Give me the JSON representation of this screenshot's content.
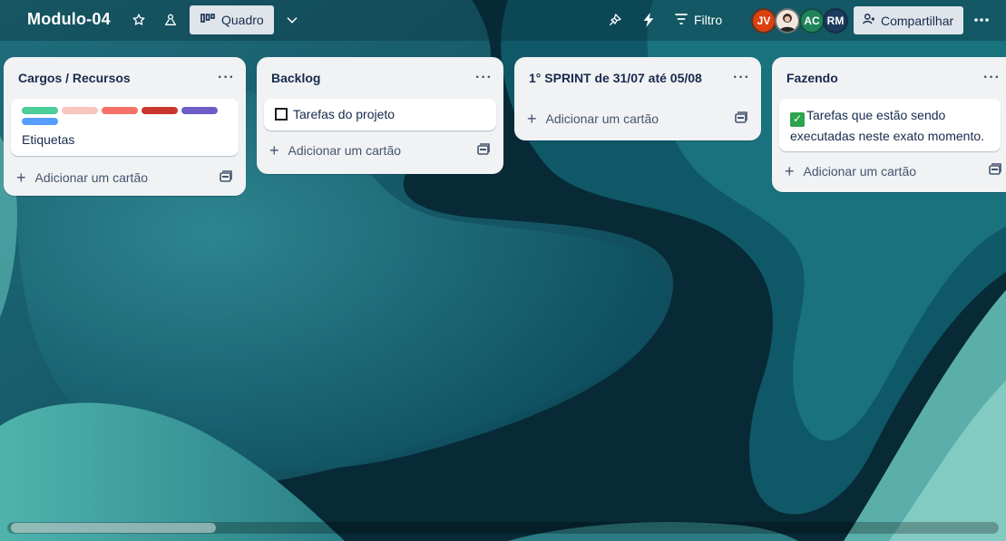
{
  "header": {
    "board_title": "Modulo-04",
    "view_label": "Quadro",
    "filter_label": "Filtro",
    "share_label": "Compartilhar",
    "avatars": [
      {
        "initials": "JV",
        "color": "#d9410f"
      },
      {
        "initials": "",
        "color": "#f4e6dd"
      },
      {
        "initials": "AC",
        "color": "#1f845a"
      },
      {
        "initials": "RM",
        "color": "#1c3a5e"
      }
    ],
    "icons": [
      "star-icon",
      "workspace-visibility-icon",
      "board-view-icon",
      "chevron-down-icon",
      "power-ups-icon",
      "automation-icon",
      "filter-icon",
      "add-member-icon",
      "more-icon"
    ]
  },
  "lists": [
    {
      "title": "Cargos / Recursos",
      "menu": "···",
      "cards": [
        {
          "text": "Etiquetas",
          "label_colors": [
            "#4bce97",
            "#f8c5bd",
            "#f87168",
            "#c9372c",
            "#6e5dc6",
            "#579dff"
          ]
        }
      ],
      "add_label": "Adicionar um cartão"
    },
    {
      "title": "Backlog",
      "menu": "···",
      "cards": [
        {
          "text": "Tarefas do projeto",
          "prefix_icon": "black-square-button"
        }
      ],
      "add_label": "Adicionar um cartão"
    },
    {
      "title": "1° SPRINT de 31/07 até 05/08",
      "menu": "···",
      "cards": [],
      "add_label": "Adicionar um cartão"
    },
    {
      "title": "Fazendo",
      "menu": "···",
      "cards": [
        {
          "text": "Tarefas que estão sendo executadas neste exato momento.",
          "prefix_icon": "white-check-mark"
        }
      ],
      "add_label": "Adicionar um cartão"
    }
  ]
}
